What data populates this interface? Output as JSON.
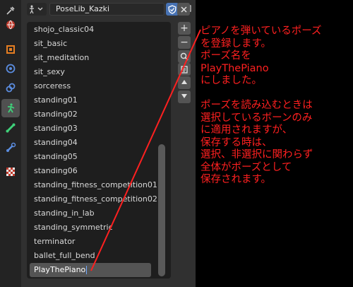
{
  "header": {
    "pose_library_name": "PoseLib_Kazki"
  },
  "properties_tabs": [
    {
      "icon": "tool-icon"
    },
    {
      "icon": "world-icon"
    },
    {
      "icon": "object-icon"
    },
    {
      "icon": "physics-icon"
    },
    {
      "icon": "constraints-icon"
    },
    {
      "icon": "armature-data-icon",
      "active": true
    },
    {
      "icon": "bone-icon"
    },
    {
      "icon": "bone-constraint-icon"
    },
    {
      "icon": "texture-icon"
    }
  ],
  "pose_list": {
    "items": [
      "shojo_classic04",
      "sit_basic",
      "sit_meditation",
      "sit_sexy",
      "sorceress",
      "standing01",
      "standing02",
      "standing03",
      "standing04",
      "standing05",
      "standing06",
      "standing_fitness_competition01",
      "standing_fitness_competition02",
      "standing_in_lab",
      "standing_symmetric",
      "terminator",
      "ballet_full_bend"
    ],
    "editing_item": "PlayThePiano"
  },
  "side_buttons": {
    "add": "+",
    "remove": "−"
  },
  "annotation": {
    "text": "ピアノを弾いているポーズ\nを登録します。\nポーズ名を\nPlayThePiano\nにしました。\n\nポーズを読み込むときは\n選択しているボーンのみ\nに適用されますが、\n保存する時は、\n選択、非選択に関わらず\n全体がポーズとして\n保存されます。",
    "color": "#ff2020"
  },
  "colors": {
    "accent": "#4772b3",
    "list_bg": "#1e1e1e",
    "panel_bg": "#303030"
  }
}
